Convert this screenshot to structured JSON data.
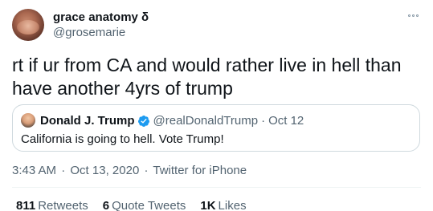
{
  "author": {
    "display_name": "grace anatomy δ",
    "handle": "@grosemarie"
  },
  "tweet": {
    "text": "rt if ur from CA and would rather live in hell than have another 4yrs of trump"
  },
  "quoted_tweet": {
    "display_name": "Donald J. Trump",
    "verified": true,
    "handle": "@realDonaldTrump",
    "separator": "·",
    "date": "Oct 12",
    "text": "California is going to hell. Vote Trump!"
  },
  "meta": {
    "time": "3:43 AM",
    "separator": "·",
    "date": "Oct 13, 2020",
    "source": "Twitter for iPhone"
  },
  "stats": {
    "retweets_count": "811",
    "retweets_label": "Retweets",
    "quotes_count": "6",
    "quotes_label": "Quote Tweets",
    "likes_count": "1K",
    "likes_label": "Likes"
  },
  "colors": {
    "verified": "#1d9bf0",
    "secondary_text": "#536471",
    "border": "#cfd9de"
  },
  "icons": {
    "more": "more-horizontal-icon",
    "verified": "verified-badge-icon"
  }
}
